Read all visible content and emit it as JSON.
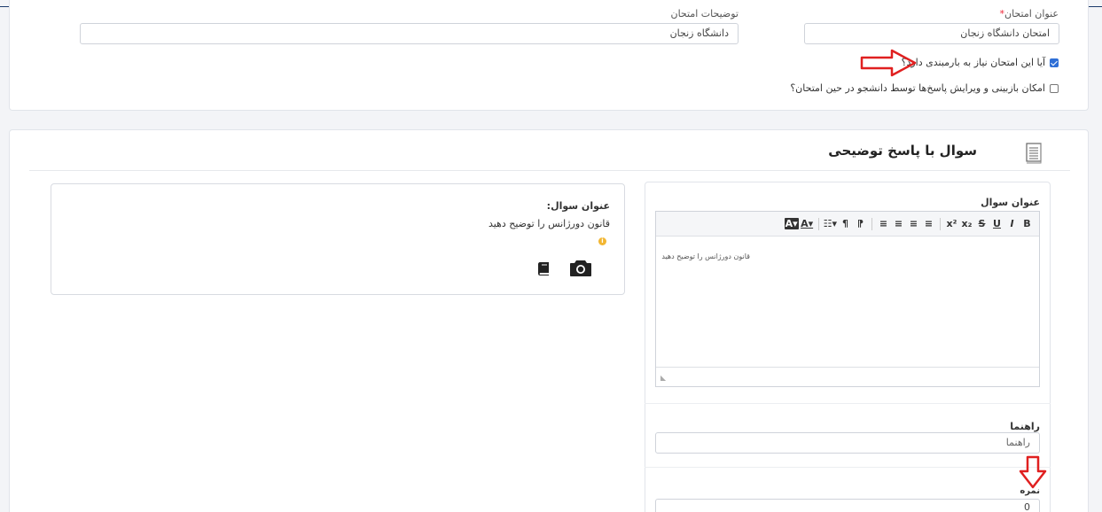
{
  "exam_form": {
    "title_label": "عنوان امتحان",
    "required_mark": "*",
    "title_value": "امتحان دانشگاه زنجان",
    "description_label": "توضیحات امتحان",
    "description_value": "دانشگاه زنجان",
    "checkbox_grading": {
      "label": "آیا این امتحان نیاز به بارمبندی دارد؟",
      "checked": true
    },
    "checkbox_review": {
      "label": "امکان بازبینی و ویرایش پاسخ‌ها توسط دانشجو در حین امتحان؟",
      "checked": false
    }
  },
  "question_section": {
    "title": "سوال با پاسخ توضیحی",
    "question_title_label": "عنوان سوال",
    "toolbar_buttons": [
      "B",
      "I",
      "U",
      "S",
      "x₂",
      "x²",
      "≡",
      "≡",
      "≡",
      "≡",
      "⁋",
      "¶",
      "☷▾",
      "A▾",
      "A▾"
    ],
    "editor_content": "قانون دورژانس را توضیح دهید",
    "hint_label": "راهنما",
    "hint_placeholder": "راهنما",
    "score_label": "نمره",
    "score_value": "0"
  },
  "preview": {
    "label": "عنوان سوال:",
    "question_text": "قانون دورژانس را توضیح دهید",
    "info_icon": "info-icon",
    "book_icon": "book-icon",
    "camera_icon": "camera-icon"
  },
  "colors": {
    "accent": "#2f6fd6",
    "annotation_arrow": "#e02020",
    "info": "#f2b632"
  }
}
